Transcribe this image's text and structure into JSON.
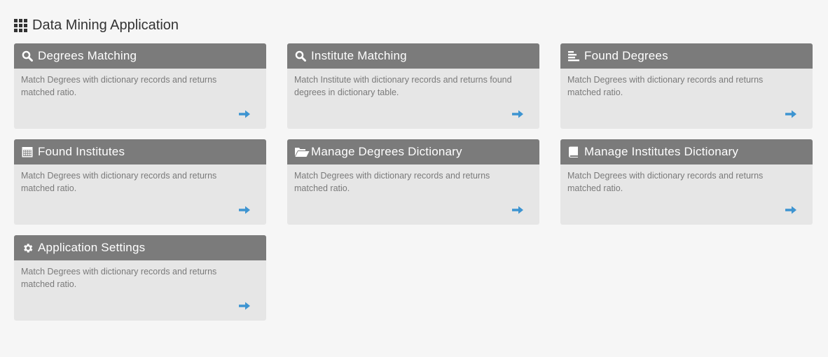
{
  "app": {
    "title": "Data Mining Application",
    "header_icon": "th-grid-icon"
  },
  "colors": {
    "page_background": "#f6f6f6",
    "card_header": "#7b7b7b",
    "card_body": "#e6e6e6",
    "arrow": "#3d94d1"
  },
  "cards": [
    {
      "title": "Degrees Matching",
      "icon": "search-icon",
      "description": "Match Degrees with dictionary records and returns matched ratio.",
      "link_icon": "arrow-right-icon"
    },
    {
      "title": "Institute Matching",
      "icon": "search-icon",
      "description": "Match Institute with dictionary records and returns found degrees in dictionary table.",
      "link_icon": "arrow-right-icon"
    },
    {
      "title": "Found Degrees",
      "icon": "align-left-icon",
      "description": "Match Degrees with dictionary records and returns matched ratio.",
      "link_icon": "arrow-right-icon"
    },
    {
      "title": "Found Institutes",
      "icon": "calendar-icon",
      "description": "Match Degrees with dictionary records and returns matched ratio.",
      "link_icon": "arrow-right-icon"
    },
    {
      "title": "Manage Degrees Dictionary",
      "icon": "folder-open-icon",
      "description": "Match Degrees with dictionary records and returns matched ratio.",
      "link_icon": "arrow-right-icon"
    },
    {
      "title": "Manage Institutes Dictionary",
      "icon": "book-icon",
      "description": "Match Degrees with dictionary records and returns matched ratio.",
      "link_icon": "arrow-right-icon"
    },
    {
      "title": "Application Settings",
      "icon": "cog-icon",
      "description": "Match Degrees with dictionary records and returns matched ratio.",
      "link_icon": "arrow-right-icon"
    }
  ]
}
